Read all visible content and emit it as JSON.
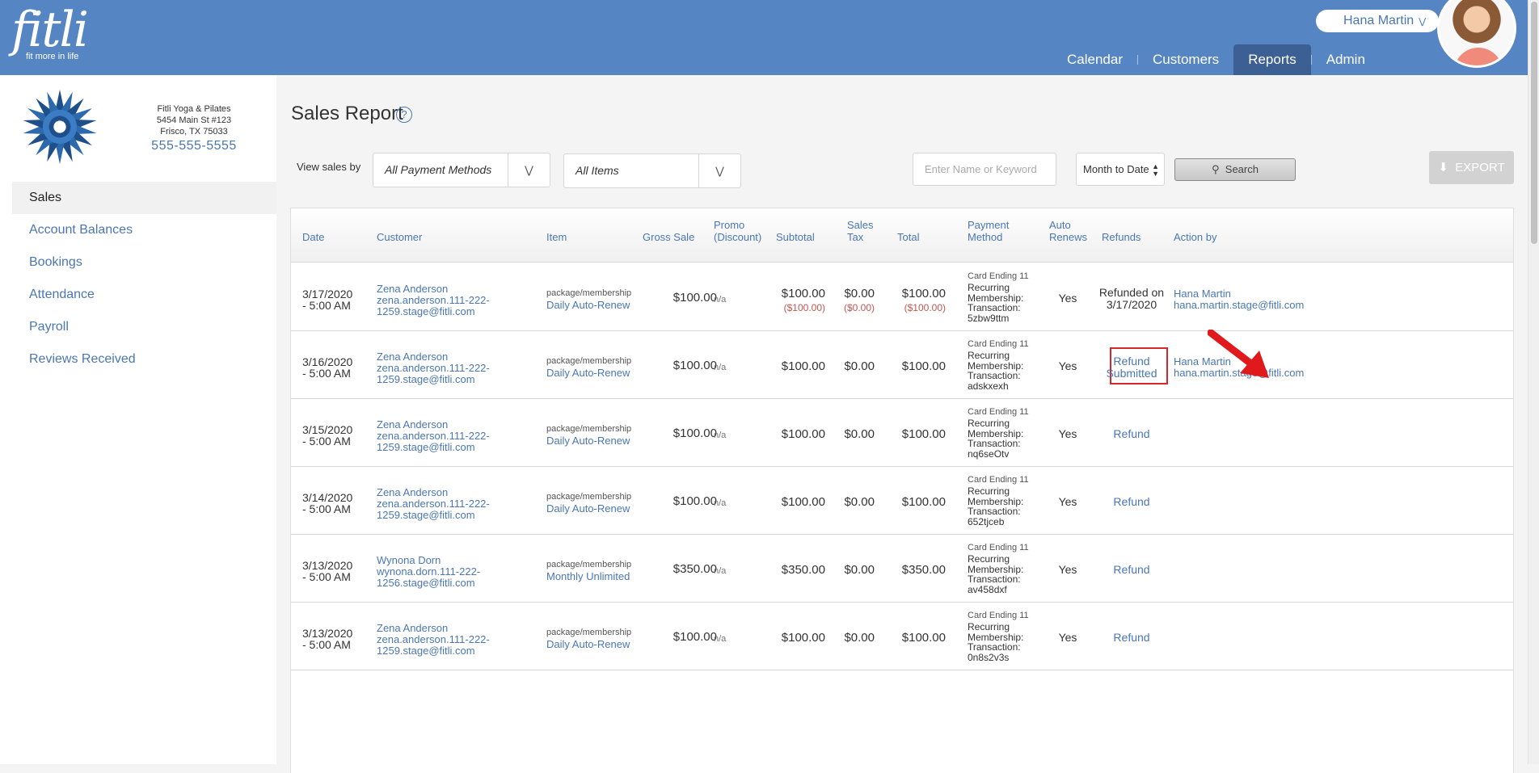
{
  "brand": {
    "name": "fitli",
    "tagline": "fit more in life"
  },
  "user": {
    "name": "Hana Martin"
  },
  "nav": {
    "items": [
      "Calendar",
      "Customers",
      "Reports",
      "Admin"
    ],
    "active": "Reports"
  },
  "studio": {
    "name": "Fitli Yoga & Pilates",
    "address1": "5454 Main St #123",
    "address2": "Frisco, TX 75033",
    "phone": "555-555-5555"
  },
  "sidebar": {
    "items": [
      {
        "label": "Sales"
      },
      {
        "label": "Account Balances"
      },
      {
        "label": "Bookings"
      },
      {
        "label": "Attendance"
      },
      {
        "label": "Payroll"
      },
      {
        "label": "Reviews Received"
      }
    ],
    "active": "Sales"
  },
  "page": {
    "title": "Sales Report",
    "help": "?"
  },
  "filters": {
    "view_by_label": "View sales by",
    "payment_method": "All Payment Methods",
    "items": "All Items",
    "keyword_placeholder": "Enter Name or Keyword",
    "range": "Month to Date",
    "search_label": "Search",
    "export_label": "EXPORT"
  },
  "table": {
    "headers": {
      "date": "Date",
      "customer": "Customer",
      "item": "Item",
      "gross": "Gross Sale",
      "promo_1": "Promo",
      "promo_2": "(Discount)",
      "subtotal": "Subtotal",
      "tax_1": "Sales",
      "tax_2": "Tax",
      "total": "Total",
      "pay_1": "Payment",
      "pay_2": "Method",
      "auto_1": "Auto",
      "auto_2": "Renews",
      "refunds": "Refunds",
      "action": "Action by"
    },
    "rows": [
      {
        "date_1": "3/17/2020",
        "date_2": "- 5:00 AM",
        "cust_name": "Zena Anderson",
        "cust_email_1": "zena.anderson.111-222-",
        "cust_email_2": "1259.stage@fitli.com",
        "item_cat": "package/membership",
        "item_name": "Daily Auto-Renew",
        "gross": "$100.00",
        "promo": "n/a",
        "subtotal": "$100.00",
        "subtotal_neg": "($100.00)",
        "tax": "$0.00",
        "tax_neg": "($0.00)",
        "total": "$100.00",
        "total_neg": "($100.00)",
        "pay_card": "Card Ending 11",
        "pay_1": "Recurring",
        "pay_2": "Membership:",
        "pay_3": "Transaction:",
        "pay_4": "5zbw9ttm",
        "auto": "Yes",
        "refund_1": "Refunded on",
        "refund_2": "3/17/2020",
        "action_name": "Hana Martin",
        "action_email": "hana.martin.stage@fitli.com"
      },
      {
        "date_1": "3/16/2020",
        "date_2": "- 5:00 AM",
        "cust_name": "Zena Anderson",
        "cust_email_1": "zena.anderson.111-222-",
        "cust_email_2": "1259.stage@fitli.com",
        "item_cat": "package/membership",
        "item_name": "Daily Auto-Renew",
        "gross": "$100.00",
        "promo": "n/a",
        "subtotal": "$100.00",
        "tax": "$0.00",
        "total": "$100.00",
        "pay_card": "Card Ending 11",
        "pay_1": "Recurring",
        "pay_2": "Membership:",
        "pay_3": "Transaction:",
        "pay_4": "adskxexh",
        "auto": "Yes",
        "refund_1": "Refund",
        "refund_2": "Submitted",
        "action_name": "Hana Martin",
        "action_email": "hana.martin.stage@fitli.com"
      },
      {
        "date_1": "3/15/2020",
        "date_2": "- 5:00 AM",
        "cust_name": "Zena Anderson",
        "cust_email_1": "zena.anderson.111-222-",
        "cust_email_2": "1259.stage@fitli.com",
        "item_cat": "package/membership",
        "item_name": "Daily Auto-Renew",
        "gross": "$100.00",
        "promo": "n/a",
        "subtotal": "$100.00",
        "tax": "$0.00",
        "total": "$100.00",
        "pay_card": "Card Ending 11",
        "pay_1": "Recurring",
        "pay_2": "Membership:",
        "pay_3": "Transaction:",
        "pay_4": "nq6seOtv",
        "auto": "Yes",
        "refund": "Refund"
      },
      {
        "date_1": "3/14/2020",
        "date_2": "- 5:00 AM",
        "cust_name": "Zena Anderson",
        "cust_email_1": "zena.anderson.111-222-",
        "cust_email_2": "1259.stage@fitli.com",
        "item_cat": "package/membership",
        "item_name": "Daily Auto-Renew",
        "gross": "$100.00",
        "promo": "n/a",
        "subtotal": "$100.00",
        "tax": "$0.00",
        "total": "$100.00",
        "pay_card": "Card Ending 11",
        "pay_1": "Recurring",
        "pay_2": "Membership:",
        "pay_3": "Transaction:",
        "pay_4": "652tjceb",
        "auto": "Yes",
        "refund": "Refund"
      },
      {
        "date_1": "3/13/2020",
        "date_2": "- 5:00 AM",
        "cust_name": "Wynona Dorn",
        "cust_email_1": "wynona.dorn.111-222-",
        "cust_email_2": "1256.stage@fitli.com",
        "item_cat": "package/membership",
        "item_name": "Monthly Unlimited",
        "gross": "$350.00",
        "promo": "n/a",
        "subtotal": "$350.00",
        "tax": "$0.00",
        "total": "$350.00",
        "pay_card": "Card Ending 11",
        "pay_1": "Recurring",
        "pay_2": "Membership:",
        "pay_3": "Transaction:",
        "pay_4": "av458dxf",
        "auto": "Yes",
        "refund": "Refund"
      },
      {
        "date_1": "3/13/2020",
        "date_2": "- 5:00 AM",
        "cust_name": "Zena Anderson",
        "cust_email_1": "zena.anderson.111-222-",
        "cust_email_2": "1259.stage@fitli.com",
        "item_cat": "package/membership",
        "item_name": "Daily Auto-Renew",
        "gross": "$100.00",
        "promo": "n/a",
        "subtotal": "$100.00",
        "tax": "$0.00",
        "total": "$100.00",
        "pay_card": "Card Ending 11",
        "pay_1": "Recurring",
        "pay_2": "Membership:",
        "pay_3": "Transaction:",
        "pay_4": "0n8s2v3s",
        "auto": "Yes",
        "refund": "Refund"
      }
    ]
  },
  "colors": {
    "header": "#5685c4",
    "nav_active": "#3c5f94",
    "link": "#4a77b4",
    "negative": "#c0584f",
    "annotation": "#d6282b"
  },
  "icons": {
    "help": "help-icon",
    "search": "search-icon",
    "export": "download-icon",
    "dropdown": "double-chevron-down-icon"
  }
}
